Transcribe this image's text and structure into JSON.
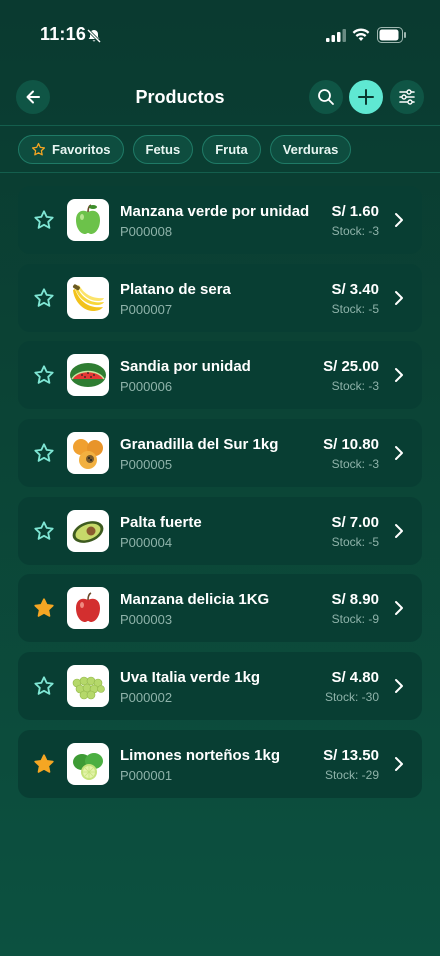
{
  "status_bar": {
    "time": "11:16",
    "icons": [
      "bell-slash-icon",
      "cellular-signal-icon",
      "wifi-icon",
      "battery-icon"
    ]
  },
  "header": {
    "title": "Productos",
    "back_icon": "arrow-left-icon",
    "search_icon": "search-icon",
    "add_icon": "plus-icon",
    "filter_icon": "sliders-icon"
  },
  "chips": [
    {
      "label": "Favoritos",
      "icon": "star-outline-icon"
    },
    {
      "label": "Fetus"
    },
    {
      "label": "Fruta"
    },
    {
      "label": "Verduras"
    }
  ],
  "colors": {
    "accent": "#5fe8d2",
    "star_filled": "#f5a623",
    "star_outline": "#7fe6d4",
    "card_bg": "#083e33"
  },
  "products": [
    {
      "name": "Manzana verde por unidad",
      "code": "P000008",
      "price": "S/ 1.60",
      "stock": "Stock: -3",
      "favorite": false,
      "image": "green-apple"
    },
    {
      "name": "Platano de sera",
      "code": "P000007",
      "price": "S/ 3.40",
      "stock": "Stock: -5",
      "favorite": false,
      "image": "bananas"
    },
    {
      "name": "Sandia por unidad",
      "code": "P000006",
      "price": "S/ 25.00",
      "stock": "Stock: -3",
      "favorite": false,
      "image": "watermelon"
    },
    {
      "name": "Granadilla del Sur 1kg",
      "code": "P000005",
      "price": "S/ 10.80",
      "stock": "Stock: -3",
      "favorite": false,
      "image": "granadilla"
    },
    {
      "name": "Palta fuerte",
      "code": "P000004",
      "price": "S/ 7.00",
      "stock": "Stock: -5",
      "favorite": false,
      "image": "avocado"
    },
    {
      "name": "Manzana delicia 1KG",
      "code": "P000003",
      "price": "S/ 8.90",
      "stock": "Stock: -9",
      "favorite": true,
      "image": "red-apple"
    },
    {
      "name": "Uva Italia verde 1kg",
      "code": "P000002",
      "price": "S/ 4.80",
      "stock": "Stock: -30",
      "favorite": false,
      "image": "green-grapes"
    },
    {
      "name": "Limones norteños 1kg",
      "code": "P000001",
      "price": "S/ 13.50",
      "stock": "Stock: -29",
      "favorite": true,
      "image": "limes"
    }
  ]
}
